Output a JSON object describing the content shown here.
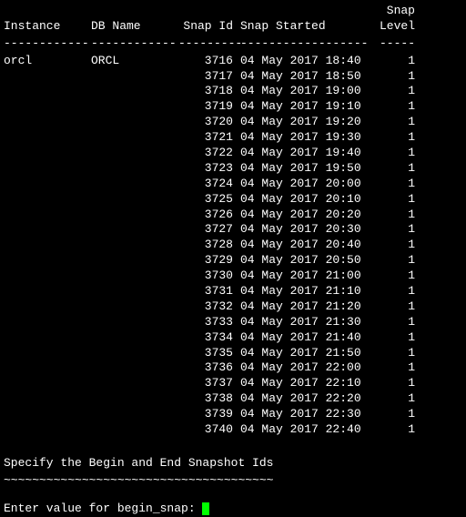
{
  "headers": {
    "instance": "Instance",
    "dbname": "DB Name",
    "snapid": "Snap Id",
    "snapstarted": "Snap Started",
    "snaplevel_top": "Snap",
    "snaplevel_bot": "Level"
  },
  "dividers": {
    "instance": "------------",
    "dbname": "------------",
    "snapid": "---------",
    "snapstarted": "------------------",
    "snaplevel": "-----"
  },
  "rows": [
    {
      "instance": "orcl",
      "dbname": "ORCL",
      "snapid": "3716",
      "started": "04 May 2017 18:40",
      "level": "1"
    },
    {
      "instance": "",
      "dbname": "",
      "snapid": "3717",
      "started": "04 May 2017 18:50",
      "level": "1"
    },
    {
      "instance": "",
      "dbname": "",
      "snapid": "3718",
      "started": "04 May 2017 19:00",
      "level": "1"
    },
    {
      "instance": "",
      "dbname": "",
      "snapid": "3719",
      "started": "04 May 2017 19:10",
      "level": "1"
    },
    {
      "instance": "",
      "dbname": "",
      "snapid": "3720",
      "started": "04 May 2017 19:20",
      "level": "1"
    },
    {
      "instance": "",
      "dbname": "",
      "snapid": "3721",
      "started": "04 May 2017 19:30",
      "level": "1"
    },
    {
      "instance": "",
      "dbname": "",
      "snapid": "3722",
      "started": "04 May 2017 19:40",
      "level": "1"
    },
    {
      "instance": "",
      "dbname": "",
      "snapid": "3723",
      "started": "04 May 2017 19:50",
      "level": "1"
    },
    {
      "instance": "",
      "dbname": "",
      "snapid": "3724",
      "started": "04 May 2017 20:00",
      "level": "1"
    },
    {
      "instance": "",
      "dbname": "",
      "snapid": "3725",
      "started": "04 May 2017 20:10",
      "level": "1"
    },
    {
      "instance": "",
      "dbname": "",
      "snapid": "3726",
      "started": "04 May 2017 20:20",
      "level": "1"
    },
    {
      "instance": "",
      "dbname": "",
      "snapid": "3727",
      "started": "04 May 2017 20:30",
      "level": "1"
    },
    {
      "instance": "",
      "dbname": "",
      "snapid": "3728",
      "started": "04 May 2017 20:40",
      "level": "1"
    },
    {
      "instance": "",
      "dbname": "",
      "snapid": "3729",
      "started": "04 May 2017 20:50",
      "level": "1"
    },
    {
      "instance": "",
      "dbname": "",
      "snapid": "3730",
      "started": "04 May 2017 21:00",
      "level": "1"
    },
    {
      "instance": "",
      "dbname": "",
      "snapid": "3731",
      "started": "04 May 2017 21:10",
      "level": "1"
    },
    {
      "instance": "",
      "dbname": "",
      "snapid": "3732",
      "started": "04 May 2017 21:20",
      "level": "1"
    },
    {
      "instance": "",
      "dbname": "",
      "snapid": "3733",
      "started": "04 May 2017 21:30",
      "level": "1"
    },
    {
      "instance": "",
      "dbname": "",
      "snapid": "3734",
      "started": "04 May 2017 21:40",
      "level": "1"
    },
    {
      "instance": "",
      "dbname": "",
      "snapid": "3735",
      "started": "04 May 2017 21:50",
      "level": "1"
    },
    {
      "instance": "",
      "dbname": "",
      "snapid": "3736",
      "started": "04 May 2017 22:00",
      "level": "1"
    },
    {
      "instance": "",
      "dbname": "",
      "snapid": "3737",
      "started": "04 May 2017 22:10",
      "level": "1"
    },
    {
      "instance": "",
      "dbname": "",
      "snapid": "3738",
      "started": "04 May 2017 22:20",
      "level": "1"
    },
    {
      "instance": "",
      "dbname": "",
      "snapid": "3739",
      "started": "04 May 2017 22:30",
      "level": "1"
    },
    {
      "instance": "",
      "dbname": "",
      "snapid": "3740",
      "started": "04 May 2017 22:40",
      "level": "1"
    }
  ],
  "section": {
    "title": "Specify the Begin and End Snapshot Ids",
    "divider": "~~~~~~~~~~~~~~~~~~~~~~~~~~~~~~~~~~~~~~"
  },
  "prompt": {
    "label": "Enter value for begin_snap: "
  }
}
